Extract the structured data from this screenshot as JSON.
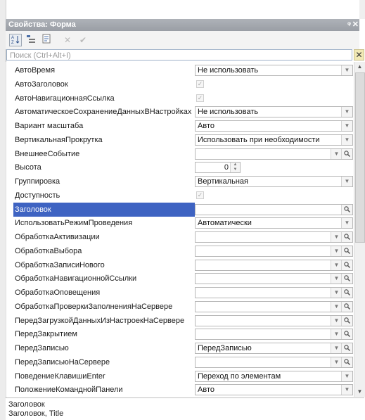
{
  "window": {
    "title": "Свойства: Форма",
    "pin_icon": "pin-icon",
    "close_icon": "close-icon"
  },
  "toolbar": {
    "items": [
      "sort-alphabetical-icon",
      "categories-icon",
      "filter-icon",
      "delete-icon",
      "check-icon"
    ]
  },
  "search": {
    "placeholder": "Поиск (Ctrl+Alt+I)",
    "value": ""
  },
  "properties": [
    {
      "name": "АвтоВремя",
      "kind": "select",
      "value": "Не использовать"
    },
    {
      "name": "АвтоЗаголовок",
      "kind": "check",
      "value": "✓"
    },
    {
      "name": "АвтоНавигационнаяСсылка",
      "kind": "check",
      "value": "✓"
    },
    {
      "name": "АвтоматическоеСохранениеДанныхВНастройках",
      "kind": "select",
      "value": "Не использовать"
    },
    {
      "name": "Вариант масштаба",
      "kind": "select",
      "value": "Авто"
    },
    {
      "name": "ВертикальнаяПрокрутка",
      "kind": "select",
      "value": "Использовать при необходимости"
    },
    {
      "name": "ВнешнееСобытие",
      "kind": "select-search",
      "value": ""
    },
    {
      "name": "Высота",
      "kind": "number",
      "value": "0"
    },
    {
      "name": "Группировка",
      "kind": "select",
      "value": "Вертикальная"
    },
    {
      "name": "Доступность",
      "kind": "check",
      "value": "✓"
    },
    {
      "name": "Заголовок",
      "kind": "search",
      "value": "",
      "selected": true
    },
    {
      "name": "ИспользоватьРежимПроведения",
      "kind": "select",
      "value": "Автоматически"
    },
    {
      "name": "ОбработкаАктивизации",
      "kind": "select-search",
      "value": ""
    },
    {
      "name": "ОбработкаВыбора",
      "kind": "select-search",
      "value": ""
    },
    {
      "name": "ОбработкаЗаписиНового",
      "kind": "select-search",
      "value": ""
    },
    {
      "name": "ОбработкаНавигационнойСсылки",
      "kind": "select-search",
      "value": ""
    },
    {
      "name": "ОбработкаОповещения",
      "kind": "select-search",
      "value": ""
    },
    {
      "name": "ОбработкаПроверкиЗаполненияНаСервере",
      "kind": "select-search",
      "value": ""
    },
    {
      "name": "ПередЗагрузкойДанныхИзНастроекНаСервере",
      "kind": "select-search",
      "value": ""
    },
    {
      "name": "ПередЗакрытием",
      "kind": "select-search",
      "value": ""
    },
    {
      "name": "ПередЗаписью",
      "kind": "select-search",
      "value": "ПередЗаписью"
    },
    {
      "name": "ПередЗаписьюНаСервере",
      "kind": "select-search",
      "value": ""
    },
    {
      "name": "ПоведениеКлавишиEnter",
      "kind": "select",
      "value": "Переход по элементам"
    },
    {
      "name": "ПоложениеКоманднойПанели",
      "kind": "select",
      "value": "Авто"
    }
  ],
  "description": {
    "line1": "Заголовок",
    "line2": "Заголовок, Title"
  }
}
